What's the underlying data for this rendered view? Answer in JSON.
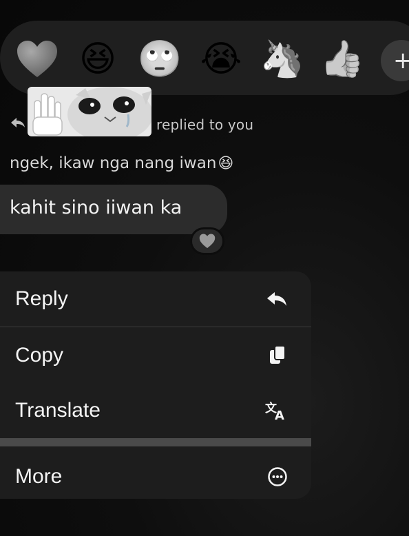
{
  "reactions": [
    {
      "name": "heart",
      "glyph": "♥"
    },
    {
      "name": "laughing",
      "glyph": "😆"
    },
    {
      "name": "eye-roll",
      "glyph": "🙄"
    },
    {
      "name": "crying",
      "glyph": "😭"
    },
    {
      "name": "unicorn",
      "glyph": "🦄"
    },
    {
      "name": "thumbs-up",
      "glyph": "👍"
    }
  ],
  "add_reaction_label": "+",
  "reply_header": {
    "text": "replied to you"
  },
  "quoted_message": {
    "text": "ngek, ikaw nga nang iwan",
    "emoji": "😆"
  },
  "message": {
    "text": "kahit sino iiwan ka",
    "reaction": "heart"
  },
  "menu": {
    "items": [
      {
        "label": "Reply",
        "icon": "reply-icon"
      },
      {
        "label": "Copy",
        "icon": "copy-icon"
      },
      {
        "label": "Translate",
        "icon": "translate-icon"
      },
      {
        "label": "More",
        "icon": "more-icon"
      }
    ]
  }
}
